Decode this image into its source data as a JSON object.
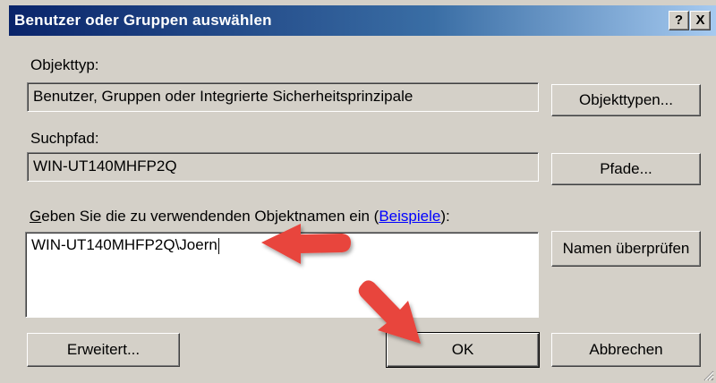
{
  "window": {
    "title": "Benutzer oder Gruppen auswählen",
    "help_button": "?",
    "close_button": "X"
  },
  "object_type": {
    "label": "Objekttyp:",
    "value": "Benutzer, Gruppen oder Integrierte Sicherheitsprinzipale",
    "button": "Objekttypen..."
  },
  "search_path": {
    "label": "Suchpfad:",
    "value": "WIN-UT140MHFP2Q",
    "button": "Pfade..."
  },
  "object_names": {
    "label_accel": "G",
    "label_rest": "eben Sie die zu verwendenden Objektnamen ein (",
    "link": "Beispiele",
    "label_end": "):",
    "value": "WIN-UT140MHFP2Q\\Joern",
    "check_button": "Namen überprüfen"
  },
  "footer": {
    "advanced_button": "Erweitert...",
    "ok_button": "OK",
    "cancel_button": "Abbrechen"
  },
  "colors": {
    "annotation_arrow": "#e8453c",
    "title_gradient_start": "#0a246a",
    "title_gradient_end": "#a6caf0"
  }
}
